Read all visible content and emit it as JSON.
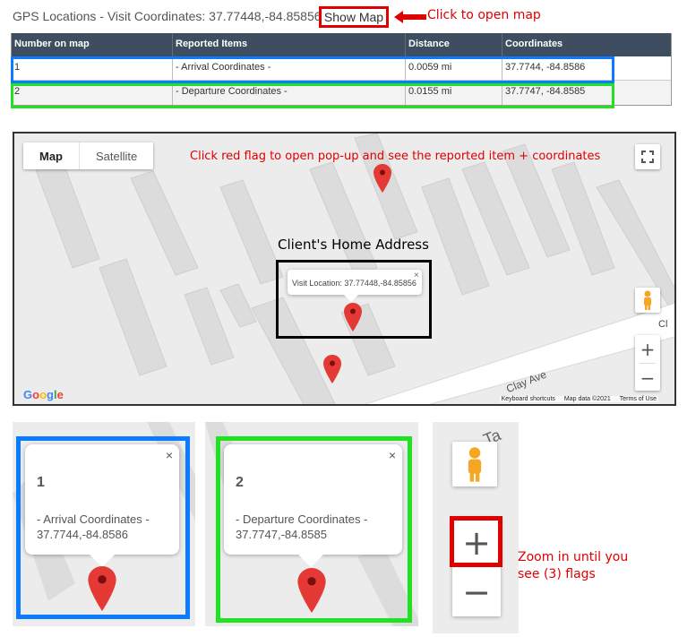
{
  "header": {
    "title": "GPS Locations - Visit Coordinates: 37.77448,-84.85856 -",
    "show_map_label": "Show Map",
    "show_map_note": "Click to open map"
  },
  "table": {
    "columns": [
      "Number on map",
      "Reported Items",
      "Distance",
      "Coordinates"
    ],
    "rows": [
      {
        "num": "1",
        "item": "- Arrival Coordinates -",
        "distance": "0.0059 mi",
        "coords": "37.7744, -84.8586"
      },
      {
        "num": "2",
        "item": "- Departure Coordinates -",
        "distance": "0.0155 mi",
        "coords": "37.7747, -84.8585"
      }
    ]
  },
  "map": {
    "tab_map": "Map",
    "tab_satellite": "Satellite",
    "flag_note": "Click red flag to open pop-up and see the reported item + coordinates",
    "home_label": "Client's Home Address",
    "popup_text": "Visit Location: 37.77448,-84.85856",
    "popup_close": "×",
    "zoom_in": "+",
    "zoom_out": "−",
    "google_logo": "Google",
    "street_name": "Clay Ave",
    "street_partial": "Cl",
    "attribution": {
      "shortcuts": "Keyboard shortcuts",
      "data": "Map data ©2021",
      "terms": "Terms of Use"
    }
  },
  "panels": {
    "arrival": {
      "number": "1",
      "line1": "- Arrival Coordinates -",
      "line2": "37.7744,-84.8586",
      "close": "×"
    },
    "departure": {
      "number": "2",
      "line1": "- Departure Coordinates -",
      "line2": "37.7747,-84.8585",
      "close": "×"
    },
    "zoom": {
      "plus": "+",
      "minus": "−",
      "street_partial": "Ta"
    },
    "zoom_note_line1": "Zoom in until you",
    "zoom_note_line2": "see (3) flags"
  },
  "colors": {
    "annotation_red": "#e00000",
    "highlight_blue": "#0b7bff",
    "highlight_green": "#22e022",
    "table_header": "#3e4e60",
    "pin_red": "#e53935"
  }
}
